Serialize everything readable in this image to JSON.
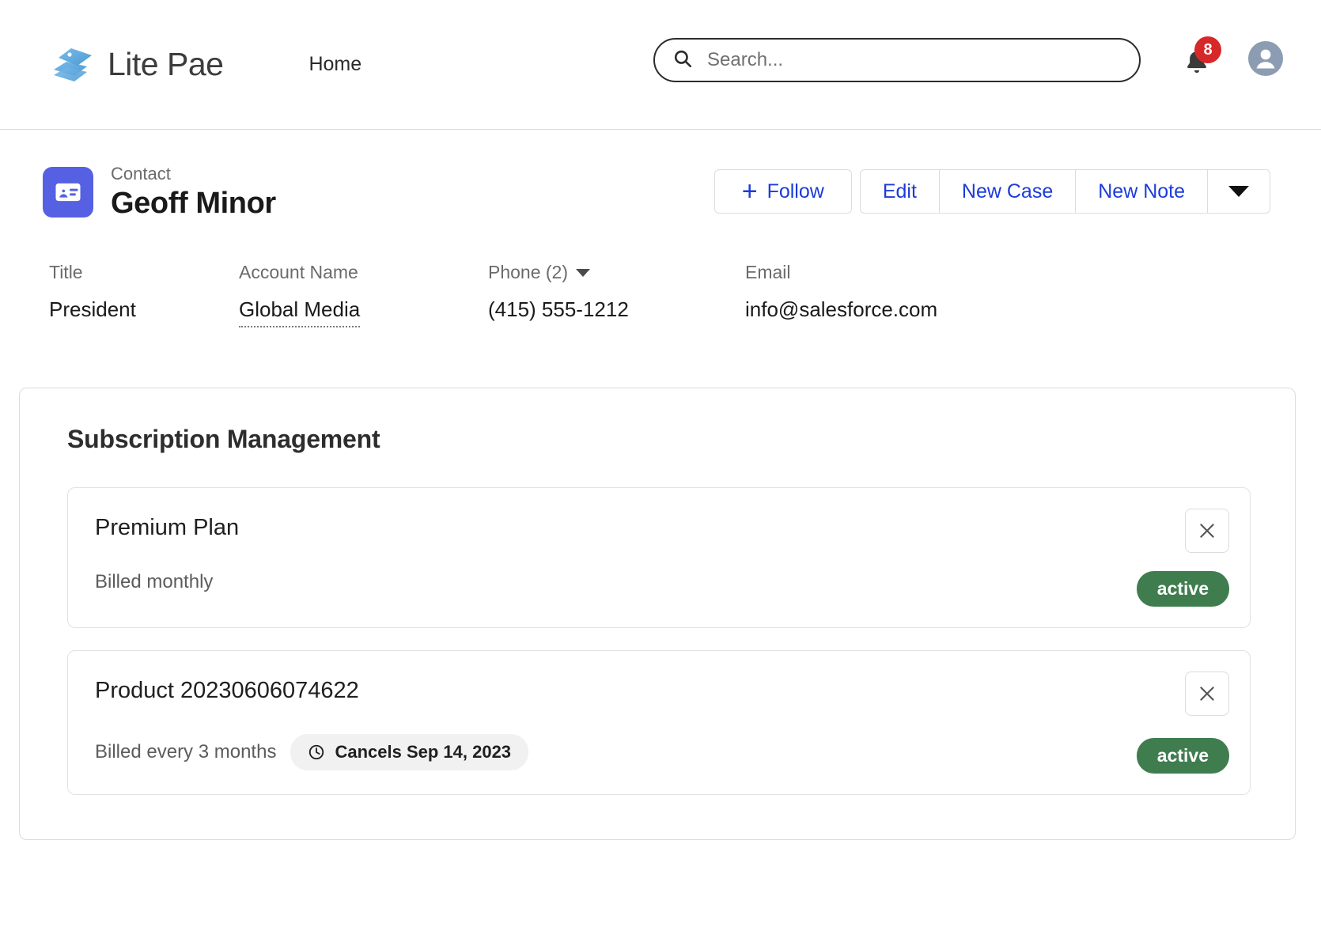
{
  "nav": {
    "brand_name": "Lite Pae",
    "brand_logo_icon": "stacked-layers-logo",
    "links": [
      {
        "label": "Home"
      }
    ],
    "search": {
      "icon": "search-icon",
      "placeholder": "Search...",
      "value": ""
    },
    "notifications": {
      "icon": "bell-icon",
      "count": "8"
    },
    "avatar_icon": "user-avatar-icon"
  },
  "record": {
    "icon": "contact-card-icon",
    "kind": "Contact",
    "name": "Geoff Minor",
    "actions": {
      "follow": "Follow",
      "follow_icon": "plus-icon",
      "edit": "Edit",
      "new_case": "New Case",
      "new_note": "New Note",
      "more_icon": "caret-down-icon"
    }
  },
  "fields": [
    {
      "label": "Title",
      "value": "President",
      "has_caret": false,
      "is_link": false
    },
    {
      "label": "Account Name",
      "value": "Global Media",
      "has_caret": false,
      "is_link": true
    },
    {
      "label": "Phone (2)",
      "value": "(415) 555-1212",
      "has_caret": true,
      "is_link": false
    },
    {
      "label": "Email",
      "value": "info@salesforce.com",
      "has_caret": false,
      "is_link": false
    }
  ],
  "subscriptions_panel": {
    "title": "Subscription Management",
    "items": [
      {
        "name": "Premium Plan",
        "billing": "Billed monthly",
        "status": "active",
        "remove_icon": "close-icon",
        "chip": null
      },
      {
        "name": "Product 20230606074622",
        "billing": "Billed every 3 months",
        "status": "active",
        "remove_icon": "close-icon",
        "chip": {
          "icon": "clock-icon",
          "label": "Cancels Sep 14, 2023"
        }
      }
    ]
  },
  "colors": {
    "accent_blue": "#1b3bdb",
    "record_icon_bg": "#5561e2",
    "badge_green": "#3f7d4f",
    "notification_red": "#d62828",
    "avatar_gray": "#8b9cb3"
  }
}
